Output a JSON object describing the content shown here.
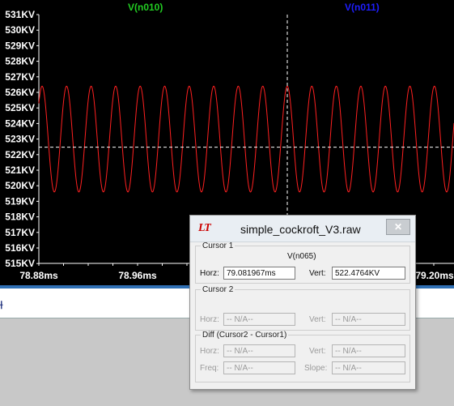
{
  "plot": {
    "traces": [
      {
        "name": "V(n010)",
        "color": "#22cc22"
      },
      {
        "name": "V(n011)",
        "color": "#1e1eff"
      }
    ],
    "y_ticks": [
      "531KV",
      "530KV",
      "529KV",
      "528KV",
      "527KV",
      "526KV",
      "525KV",
      "524KV",
      "523KV",
      "522KV",
      "521KV",
      "520KV",
      "519KV",
      "518KV",
      "517KV",
      "516KV",
      "515KV"
    ],
    "x_ticks": [
      "78.88ms",
      "78.96ms",
      "79.20ms"
    ],
    "trace_color": "#ff2020",
    "cursor_horizontal_kv": 522.4764
  },
  "dialog": {
    "logo": "LT",
    "title": "simple_cockroft_V3.raw",
    "close": "✕",
    "cursor1": {
      "legend": "Cursor 1",
      "trace": "V(n065)",
      "horz_label": "Horz:",
      "horz_value": "79.081967ms",
      "vert_label": "Vert:",
      "vert_value": "522.4764KV"
    },
    "cursor2": {
      "legend": "Cursor 2",
      "horz_label": "Horz:",
      "horz_value": "-- N/A--",
      "vert_label": "Vert:",
      "vert_value": "-- N/A--"
    },
    "diff": {
      "legend": "Diff (Cursor2 - Cursor1)",
      "horz_label": "Horz:",
      "horz_value": "-- N/A--",
      "vert_label": "Vert:",
      "vert_value": "-- N/A--",
      "freq_label": "Freq:",
      "freq_value": "-- N/A--",
      "slope_label": "Slope:",
      "slope_value": "-- N/A--"
    }
  },
  "bottom": {
    "schematic_glyph": "⟊"
  }
}
